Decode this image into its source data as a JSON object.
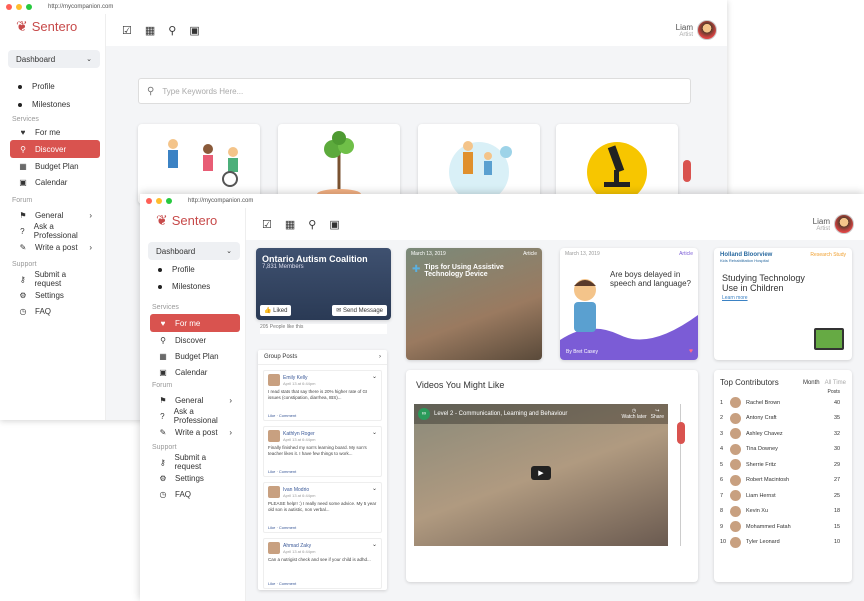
{
  "back_window": {
    "url": "http://mycompanion.com",
    "brand": "Sentero",
    "sidebar": {
      "dashboard": "Dashboard",
      "sub": [
        "Profile",
        "Milestones"
      ],
      "services_title": "Services",
      "services": [
        {
          "label": "For me",
          "icon": "heart-icon"
        },
        {
          "label": "Discover",
          "icon": "search-icon",
          "active": true
        },
        {
          "label": "Budget Plan",
          "icon": "calculator-icon"
        },
        {
          "label": "Calendar",
          "icon": "calendar-icon"
        }
      ],
      "forum_title": "Forum",
      "forum": [
        {
          "label": "General",
          "icon": "flag-icon"
        },
        {
          "label": "Ask a Professional",
          "icon": "question-icon"
        },
        {
          "label": "Write a post",
          "icon": "edit-icon"
        }
      ],
      "support_title": "Support",
      "support": [
        {
          "label": "Submit a request",
          "icon": "key-icon"
        },
        {
          "label": "Settings",
          "icon": "gear-icon"
        },
        {
          "label": "FAQ",
          "icon": "faq-icon"
        }
      ]
    },
    "user": {
      "name": "Liam",
      "role": "Artist"
    },
    "search_placeholder": "Type Keywords Here..."
  },
  "front_window": {
    "url": "http://mycompanion.com",
    "brand": "Sentero",
    "sidebar": {
      "dashboard": "Dashboard",
      "sub": [
        "Profile",
        "Milestones"
      ],
      "services_title": "Services",
      "services": [
        {
          "label": "For me",
          "icon": "heart-icon",
          "active": true
        },
        {
          "label": "Discover",
          "icon": "search-icon"
        },
        {
          "label": "Budget Plan",
          "icon": "calculator-icon"
        },
        {
          "label": "Calendar",
          "icon": "calendar-icon"
        }
      ],
      "forum_title": "Forum",
      "forum": [
        {
          "label": "General",
          "icon": "flag-icon"
        },
        {
          "label": "Ask a Professional",
          "icon": "question-icon"
        },
        {
          "label": "Write a post",
          "icon": "edit-icon"
        }
      ],
      "support_title": "Support",
      "support": [
        {
          "label": "Submit a request",
          "icon": "key-icon"
        },
        {
          "label": "Settings",
          "icon": "gear-icon"
        },
        {
          "label": "FAQ",
          "icon": "faq-icon"
        }
      ]
    },
    "user": {
      "name": "Liam",
      "role": "Artist"
    },
    "group": {
      "name": "Ontario Autism Coalition",
      "members": "7,831 Members",
      "liked": "Liked",
      "send": "Send Message",
      "people": "205 People like this",
      "posts_title": "Group Posts",
      "posts": [
        {
          "author": "Emily Kelly",
          "date": "April 13 at 6:44pm",
          "text": "I read stats that say there is 20% higher rate of GI issues (constipation, diarrhea, IBS)...",
          "actions": "Like · Comment"
        },
        {
          "author": "Kathlyn Roger",
          "date": "April 13 at 6:44pm",
          "text": "Finally finished my son's learning board. My son's teacher likes it. I have few things to work...",
          "actions": "Like · Comment"
        },
        {
          "author": "Ivan Modrio",
          "date": "April 13 at 6:44pm",
          "text": "PLEASE help!! :) I really need some advice. My 5 year old son is autistic, non verbal...",
          "actions": "Like · Comment"
        },
        {
          "author": "Ahmad Zaky",
          "date": "April 13 at 6:44pm",
          "text": "Can a nutrigist check and see if your child is adhd...",
          "actions": "Like · Comment"
        }
      ]
    },
    "article1": {
      "date": "March 13, 2019",
      "tag": "Article",
      "title": "Tips for Using Assistive Technology Device"
    },
    "article2": {
      "date": "March 13, 2019",
      "tag": "Article",
      "title": "Are boys delayed in speech and language?",
      "author": "By Bret Casey"
    },
    "study": {
      "logo": "Holland Bloorview",
      "logo_sub": "Kids Rehabilitation Hospital",
      "tag": "Research Study",
      "title": "Studying Technology Use in Children",
      "link": "Learn more"
    },
    "videos": {
      "title": "Videos You Might Like",
      "video_title": "Level 2 - Communication, Learning and Behaviour",
      "watch_later": "Watch later",
      "share": "Share"
    },
    "contributors": {
      "title": "Top Contributors",
      "tab_month": "Month",
      "tab_all": "All Time",
      "posts_label": "Posts",
      "rows": [
        {
          "rank": "1",
          "name": "Rachel Brown",
          "posts": "40"
        },
        {
          "rank": "2",
          "name": "Antony Craft",
          "posts": "35"
        },
        {
          "rank": "3",
          "name": "Ashley Chavez",
          "posts": "32"
        },
        {
          "rank": "4",
          "name": "Tina Downey",
          "posts": "30"
        },
        {
          "rank": "5",
          "name": "Sherrie Fritz",
          "posts": "29"
        },
        {
          "rank": "6",
          "name": "Robert Macintosh",
          "posts": "27"
        },
        {
          "rank": "7",
          "name": "Liam Hernst",
          "posts": "25"
        },
        {
          "rank": "8",
          "name": "Kevin Xu",
          "posts": "18"
        },
        {
          "rank": "9",
          "name": "Mohammed Fatah",
          "posts": "15"
        },
        {
          "rank": "10",
          "name": "Tyler Leonard",
          "posts": "10"
        }
      ]
    }
  },
  "colors": {
    "accent": "#d9534f",
    "brand": "#c74a4a",
    "purple": "#7b5cd6",
    "orange": "#f0a030"
  }
}
